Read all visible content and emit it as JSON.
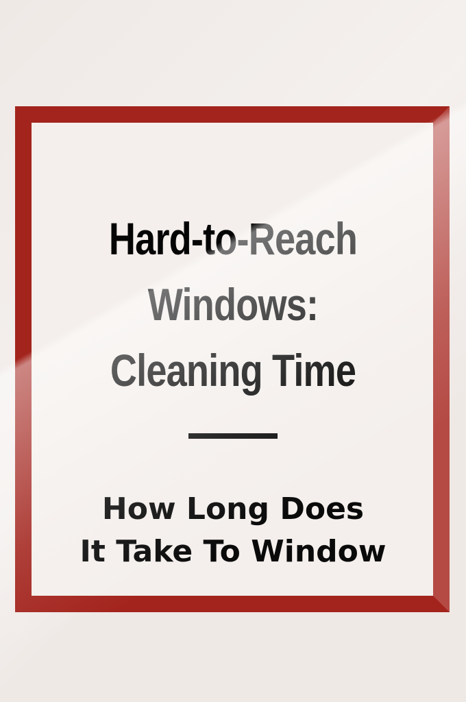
{
  "headline": {
    "line1": "Hard-to-Reach",
    "line2": "Windows:",
    "line3": "Cleaning Time"
  },
  "subheadline": {
    "line1": "How Long Does",
    "line2": "It Take To Window"
  },
  "colors": {
    "frame": "#a3241d",
    "background": "#efe9e6",
    "text": "#050505"
  }
}
